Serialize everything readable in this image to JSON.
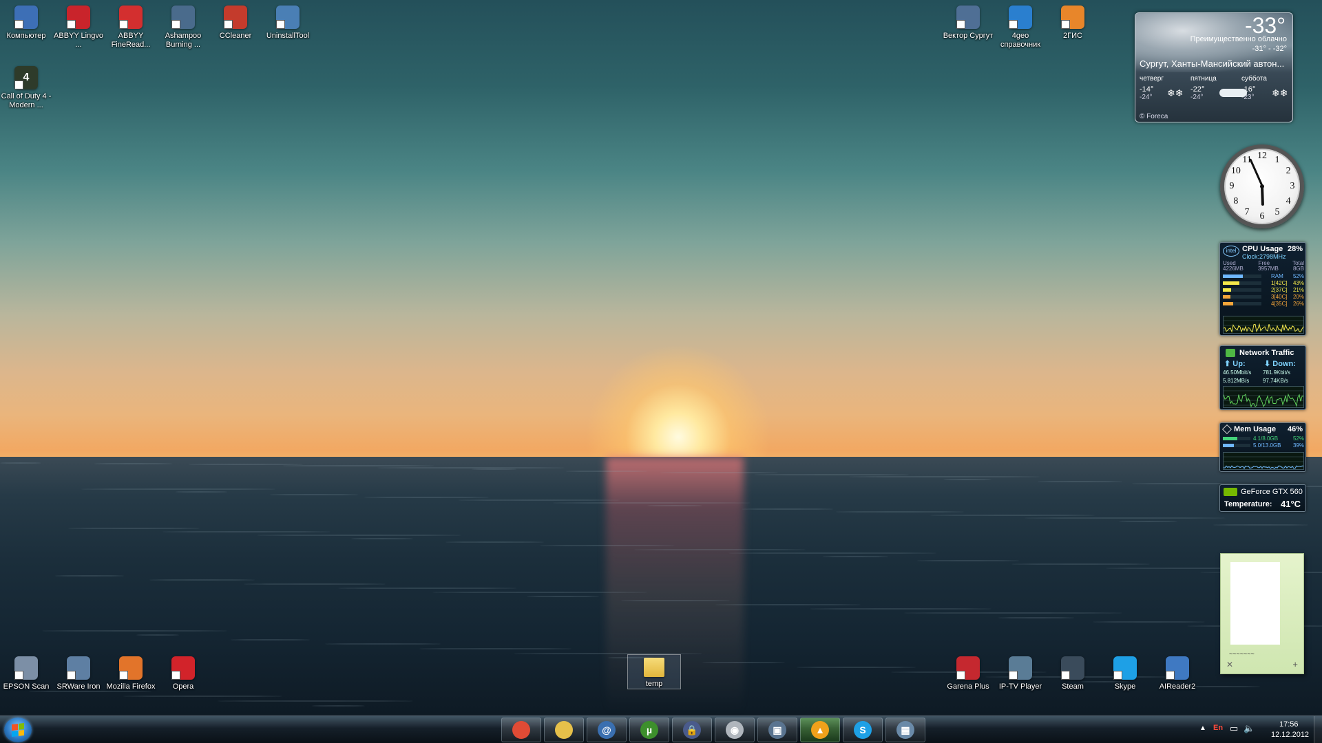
{
  "desktop_icons_top_left": [
    {
      "label": "Компьютер",
      "icon": "computer-icon",
      "color": "#3d6fb6"
    },
    {
      "label": "ABBYY Lingvo ...",
      "icon": "abbyy-lingvo-icon",
      "color": "#c9242b"
    },
    {
      "label": "ABBYY FineRead...",
      "icon": "abbyy-finereader-icon",
      "color": "#d32f2f"
    },
    {
      "label": "Ashampoo Burning ...",
      "icon": "ashampoo-burning-icon",
      "color": "#4a6b8c"
    },
    {
      "label": "CCleaner",
      "icon": "ccleaner-icon",
      "color": "#c43b2c"
    },
    {
      "label": "UninstallTool",
      "icon": "uninstalltool-icon",
      "color": "#4a7fb5"
    }
  ],
  "desktop_icon_cod": {
    "label": "Call of Duty 4 - Modern ...",
    "icon": "call-of-duty-icon",
    "color": "#2e3b2a"
  },
  "desktop_icons_top_right": [
    {
      "label": "Вектор Сургут",
      "icon": "vektor-surgut-icon",
      "color": "#4f6f95"
    },
    {
      "label": "4geo справочник",
      "icon": "4geo-icon",
      "color": "#2a7fcf"
    },
    {
      "label": "2ГИС",
      "icon": "2gis-icon",
      "color": "#e8862a"
    }
  ],
  "desktop_icons_bottom_left": [
    {
      "label": "EPSON Scan",
      "icon": "epson-scan-icon",
      "color": "#7c8fa6"
    },
    {
      "label": "SRWare Iron",
      "icon": "srware-iron-icon",
      "color": "#5e7fa3"
    },
    {
      "label": "Mozilla Firefox",
      "icon": "firefox-icon",
      "color": "#e2742a"
    },
    {
      "label": "Opera",
      "icon": "opera-icon",
      "color": "#d2232a"
    }
  ],
  "desktop_icon_temp": {
    "label": "temp",
    "icon": "folder-icon",
    "color": "#e6c04a"
  },
  "desktop_icons_bottom_right": [
    {
      "label": "Garena Plus",
      "icon": "garena-plus-icon",
      "color": "#c5282f"
    },
    {
      "label": "IP-TV Player",
      "icon": "iptv-player-icon",
      "color": "#5a7c96"
    },
    {
      "label": "Steam",
      "icon": "steam-icon",
      "color": "#3a4b5b"
    },
    {
      "label": "Skype",
      "icon": "skype-icon",
      "color": "#1ea0e6"
    },
    {
      "label": "AIReader2",
      "icon": "alreader-icon",
      "color": "#3f79c2"
    }
  ],
  "weather": {
    "temp": "-33°",
    "condition": "Преимущественно облачно",
    "range": "-31° - -32°",
    "city": "Сургут, Ханты-Мансийский автон...",
    "days": [
      {
        "name": "четверг",
        "hi": "-14°",
        "lo": "-24°"
      },
      {
        "name": "пятница",
        "hi": "-22°",
        "lo": "-24°"
      },
      {
        "name": "суббота",
        "hi": "-16°",
        "lo": "-23°"
      }
    ],
    "credit": "© Foreca"
  },
  "clock": {
    "numbers": [
      "12",
      "1",
      "2",
      "3",
      "4",
      "5",
      "6",
      "7",
      "8",
      "9",
      "10",
      "11"
    ],
    "hour": 5,
    "minute": 56
  },
  "cpu": {
    "logo": "intel",
    "title": "CPU Usage",
    "percent": "28%",
    "clock": "Clock:2798MHz",
    "mem_headers": [
      "Used",
      "Free",
      "Total"
    ],
    "mem_values": [
      "4226MB",
      "3957MB",
      "8GB"
    ],
    "rows": [
      {
        "name": "RAM",
        "value": "52%",
        "fill": 0.52,
        "color": "#6fb8ff"
      },
      {
        "name": "1[42C]",
        "value": "43%",
        "fill": 0.43,
        "color": "#f5e84a"
      },
      {
        "name": "2[37C]",
        "value": "21%",
        "fill": 0.21,
        "color": "#f5e84a"
      },
      {
        "name": "3[40C]",
        "value": "20%",
        "fill": 0.2,
        "color": "#f5a63a"
      },
      {
        "name": "4[35C]",
        "value": "26%",
        "fill": 0.26,
        "color": "#f5a63a"
      }
    ]
  },
  "network": {
    "title": "Network Traffic",
    "up_label": "Up:",
    "down_label": "Down:",
    "up_speed": "46.50Mbit/s",
    "down_speed": "781.9Kbit/s",
    "up_bytes": "5.812MB/s",
    "down_bytes": "97.74KB/s"
  },
  "memory": {
    "title": "Mem Usage",
    "percent": "46%",
    "rows": [
      {
        "label": "4.1/8.0GB",
        "value": "52%",
        "fill": 0.52,
        "color": "#44d47a"
      },
      {
        "label": "5.0/13.0GB",
        "value": "39%",
        "fill": 0.39,
        "color": "#6fb8ff"
      }
    ]
  },
  "gpu": {
    "title": "GeForce GTX 560",
    "temp_label": "Temperature:",
    "temp_value": "41°C"
  },
  "taskbar": {
    "apps": [
      {
        "name": "chrome",
        "icon": "chrome-icon",
        "glyph": "",
        "color": "#e04b35"
      },
      {
        "name": "explorer",
        "icon": "folder-icon",
        "glyph": "",
        "color": "#e6c04a"
      },
      {
        "name": "mail",
        "icon": "mail-client-icon",
        "glyph": "@",
        "color": "#3a6fb0"
      },
      {
        "name": "utorrent",
        "icon": "utorrent-icon",
        "glyph": "µ",
        "color": "#3d8f2c"
      },
      {
        "name": "security",
        "icon": "lock-icon",
        "glyph": "🔒",
        "color": "#4a5b8c"
      },
      {
        "name": "media",
        "icon": "disc-icon",
        "glyph": "◉",
        "color": "#b0b6bd"
      },
      {
        "name": "window",
        "icon": "window-app-icon",
        "glyph": "▣",
        "color": "#5a7490"
      },
      {
        "name": "aimp",
        "icon": "aimp-icon",
        "glyph": "▲",
        "color": "#f0a11b"
      },
      {
        "name": "skype",
        "icon": "skype-icon",
        "glyph": "S",
        "color": "#1ea0e6"
      },
      {
        "name": "control",
        "icon": "control-panel-icon",
        "glyph": "▦",
        "color": "#6a8aa8"
      }
    ],
    "active_index": 7,
    "tray_lang": "En",
    "time": "17:56",
    "date": "12.12.2012"
  }
}
